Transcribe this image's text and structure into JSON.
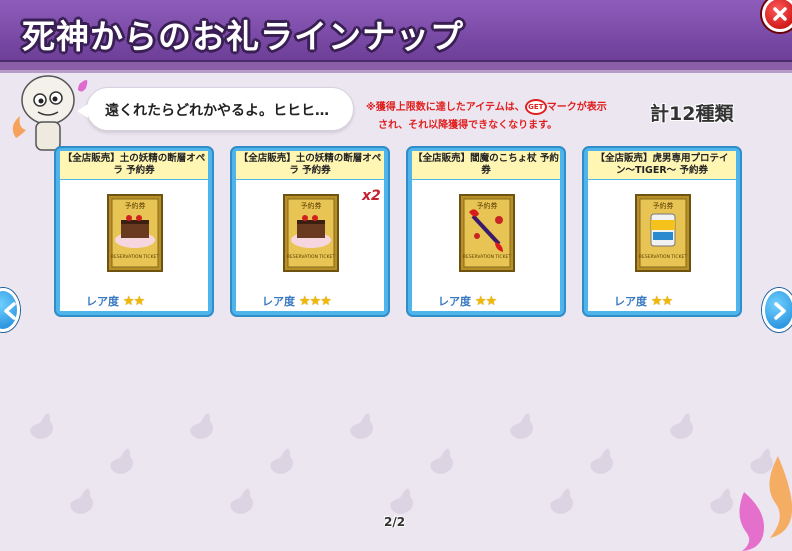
{
  "header": {
    "title": "死神からのお礼ラインナップ"
  },
  "mascot": {
    "speech": "遠くれたらどれかやるよ。ヒヒヒ…"
  },
  "notice": {
    "line1_prefix": "※獲得上限数に達したアイテムは、",
    "get_mark": "GET",
    "line1_suffix": "マークが表示",
    "line2": "され、それ以降獲得できなくなります。"
  },
  "total": "計12種類",
  "cards": [
    {
      "name": "【全店販売】土の妖精の断層オペラ 予約券",
      "rarity_label": "レア度",
      "stars": "★★",
      "rarity": 2,
      "ticket_label": "予約券",
      "ticket_sub": "RESERVATION TICKET",
      "qty": ""
    },
    {
      "name": "【全店販売】土の妖精の断層オペラ 予約券",
      "rarity_label": "レア度",
      "stars": "★★★",
      "rarity": 3,
      "ticket_label": "予約券",
      "ticket_sub": "RESERVATION TICKET",
      "qty": "x2"
    },
    {
      "name": "【全店販売】閻魔のこちょ杖 予約券",
      "rarity_label": "レア度",
      "stars": "★★",
      "rarity": 2,
      "ticket_label": "予約券",
      "ticket_sub": "RESERVATION TICKET",
      "qty": ""
    },
    {
      "name": "【全店販売】虎男専用プロテイン〜TIGER〜 予約券",
      "rarity_label": "レア度",
      "stars": "★★",
      "rarity": 2,
      "ticket_label": "予約券",
      "ticket_sub": "RESERVATION TICKET",
      "qty": ""
    }
  ],
  "pager": "2/2",
  "colors": {
    "header": "#7a4aa8",
    "card": "#4fb4ea",
    "name_bg": "#fff6b3",
    "notice": "#e02020",
    "rarity": "#3b78c2",
    "star": "#f1b900"
  },
  "icons": {
    "close": "close-icon",
    "prev": "chevron-left-icon",
    "next": "chevron-right-icon"
  }
}
